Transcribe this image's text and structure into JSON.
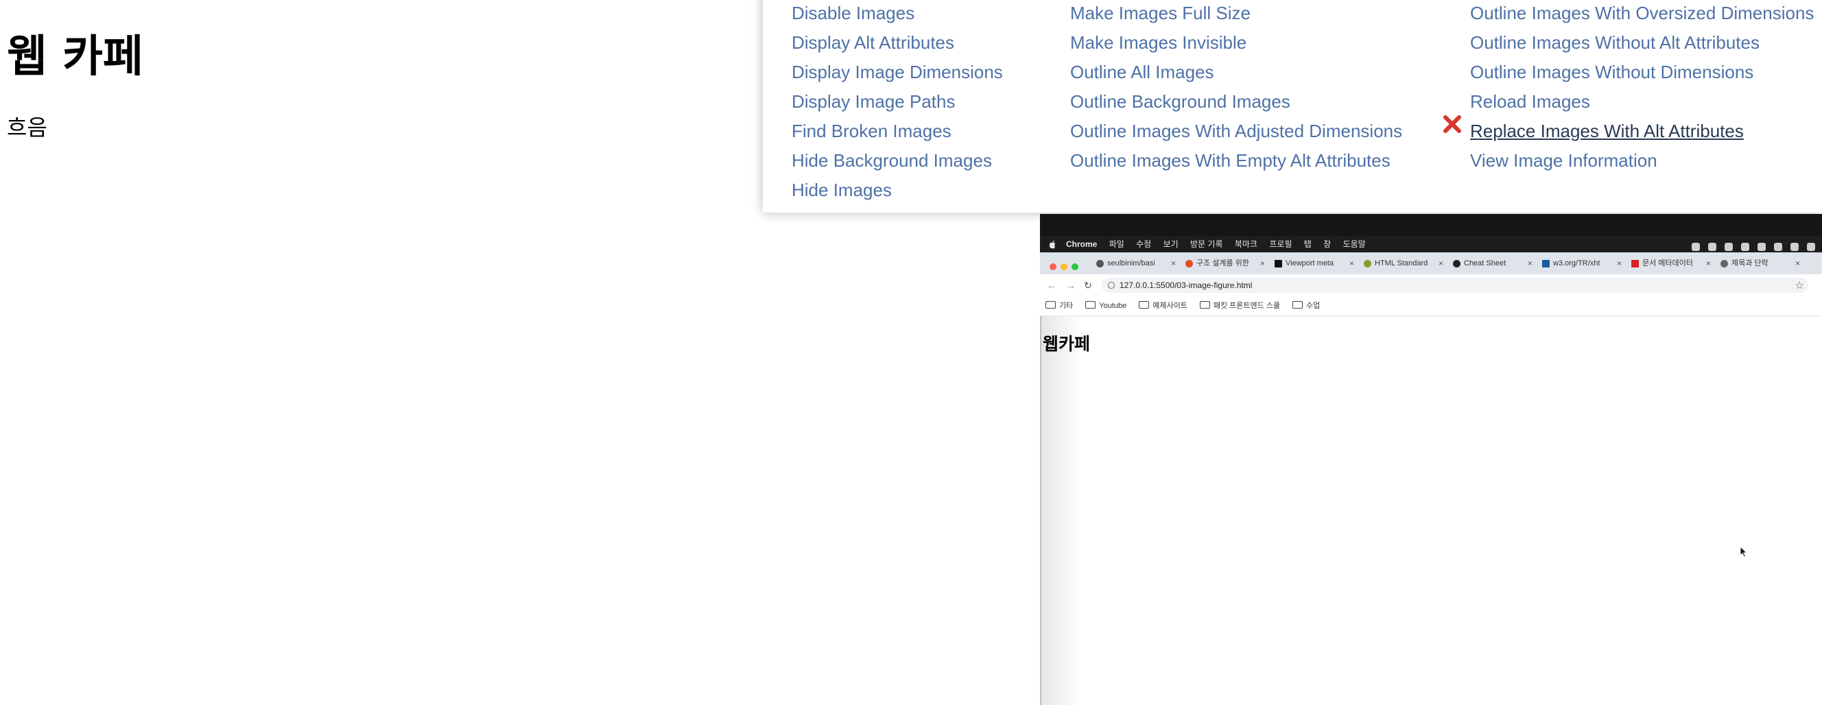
{
  "page": {
    "title": "웹 카페",
    "caption": "흐음"
  },
  "images_menu": {
    "columns": [
      [
        "Disable Images",
        "Display Alt Attributes",
        "Display Image Dimensions",
        "Display Image Paths",
        "Find Broken Images",
        "Hide Background Images",
        "Hide Images"
      ],
      [
        "Make Images Full Size",
        "Make Images Invisible",
        "Outline All Images",
        "Outline Background Images",
        "Outline Images With Adjusted Dimensions",
        "Outline Images With Empty Alt Attributes"
      ],
      [
        "Outline Images With Oversized Dimensions",
        "Outline Images Without Alt Attributes",
        "Outline Images Without Dimensions",
        "Reload Images",
        "Replace Images With Alt Attributes",
        "View Image Information"
      ]
    ],
    "active_item": "Replace Images With Alt Attributes",
    "active_icon": "red-x-icon",
    "link_color": "#4e71a6",
    "active_color": "#2a3a55",
    "x_color": "#d6382c"
  },
  "screenshot": {
    "menubar": {
      "app": "Chrome",
      "items": [
        "파일",
        "수정",
        "보기",
        "방문 기록",
        "북마크",
        "프로필",
        "탭",
        "창",
        "도움말"
      ]
    },
    "tabs": [
      {
        "title": "seulbinim/basi",
        "icon": "github-icon"
      },
      {
        "title": "구조 설계를 위한",
        "icon": "html5-icon"
      },
      {
        "title": "Viewport meta",
        "icon": "mdn-icon"
      },
      {
        "title": "HTML Standard",
        "icon": "help-icon"
      },
      {
        "title": "Cheat Sheet",
        "icon": "cheatsheet-icon"
      },
      {
        "title": "w3.org/TR/xht",
        "icon": "w3c-icon"
      },
      {
        "title": "문서 메타데이터",
        "icon": "netflix-icon"
      },
      {
        "title": "제목과 단락",
        "icon": "link-icon"
      }
    ],
    "url": "127.0.0.1:5500/03-image-figure.html",
    "bookmarks": [
      {
        "label": "기타"
      },
      {
        "label": "Youtube"
      },
      {
        "label": "예제사이트"
      },
      {
        "label": "패킷 프론트엔드 스쿨"
      },
      {
        "label": "수업"
      }
    ],
    "heading": "웹카페"
  }
}
